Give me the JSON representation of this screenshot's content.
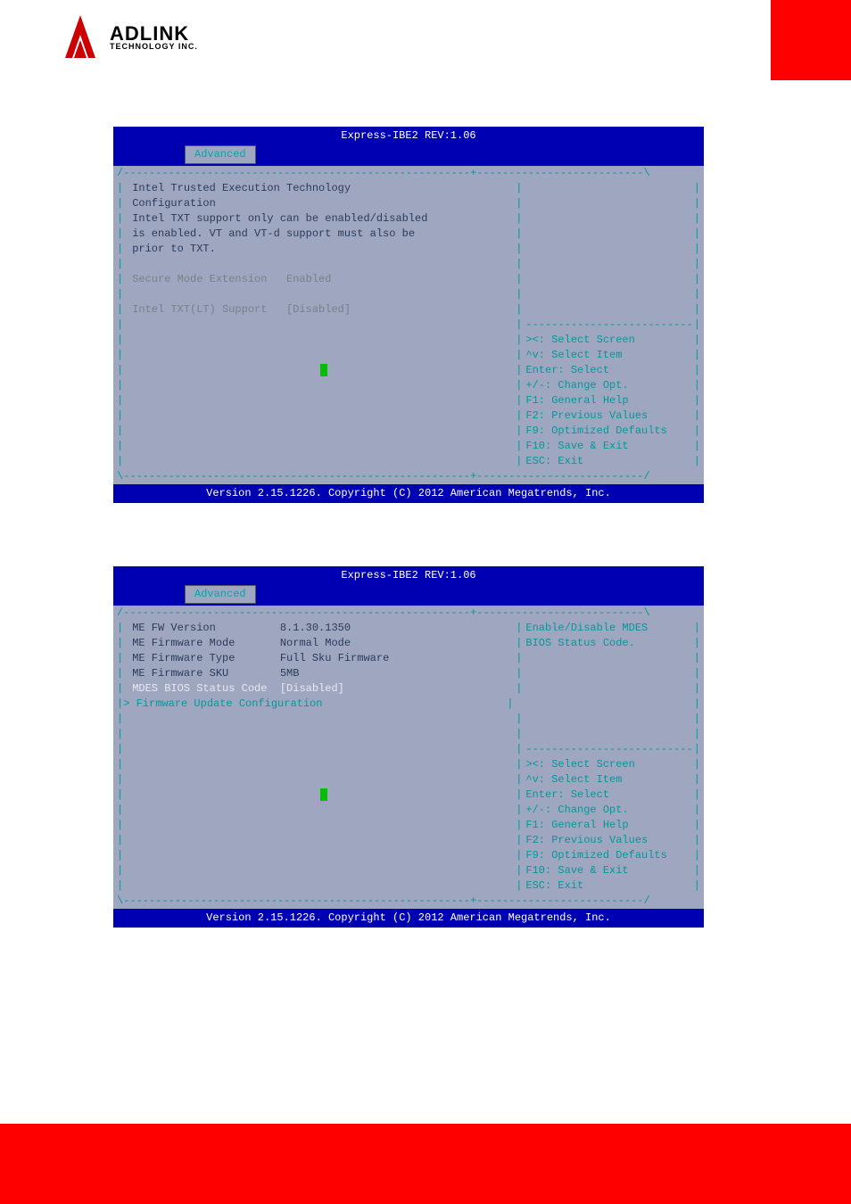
{
  "logo": {
    "main": "ADLINK",
    "sub": "TECHNOLOGY INC."
  },
  "bios1": {
    "title": "Express-IBE2 REV:1.06",
    "tab": "Advanced",
    "left_lines": [
      "Intel Trusted Execution Technology",
      "Configuration",
      "Intel TXT support only can be enabled/disabled",
      "is enabled. VT and VT-d support must also be",
      "prior to TXT.",
      "",
      "Secure Mode Extension   Enabled",
      "",
      "Intel TXT(LT) Support   [Disabled]"
    ],
    "help": [
      "><: Select Screen",
      "^v: Select Item",
      "Enter: Select",
      "+/-: Change Opt.",
      "F1: General Help",
      "F2: Previous Values",
      "F9: Optimized Defaults",
      "F10: Save & Exit",
      "ESC: Exit"
    ],
    "footer": "Version 2.15.1226. Copyright (C) 2012 American Megatrends, Inc."
  },
  "bios2": {
    "title": "Express-IBE2 REV:1.06",
    "tab": "Advanced",
    "left_rows": [
      {
        "label": "ME FW Version",
        "value": "8.1.30.1350",
        "class": ""
      },
      {
        "label": "ME Firmware Mode",
        "value": "Normal Mode",
        "class": ""
      },
      {
        "label": "ME Firmware Type",
        "value": "Full Sku Firmware",
        "class": ""
      },
      {
        "label": "ME Firmware SKU",
        "value": "5MB",
        "class": ""
      },
      {
        "label": "MDES BIOS Status Code",
        "value": "[Disabled]",
        "class": "white"
      },
      {
        "label": "Firmware Update Configuration",
        "value": "",
        "class": "submenu"
      }
    ],
    "right_desc": [
      "Enable/Disable MDES",
      "BIOS Status Code."
    ],
    "help": [
      "><: Select Screen",
      "^v: Select Item",
      "Enter: Select",
      "+/-: Change Opt.",
      "F1: General Help",
      "F2: Previous Values",
      "F9: Optimized Defaults",
      "F10: Save & Exit",
      "ESC: Exit"
    ],
    "footer": "Version 2.15.1226. Copyright (C) 2012 American Megatrends, Inc."
  }
}
